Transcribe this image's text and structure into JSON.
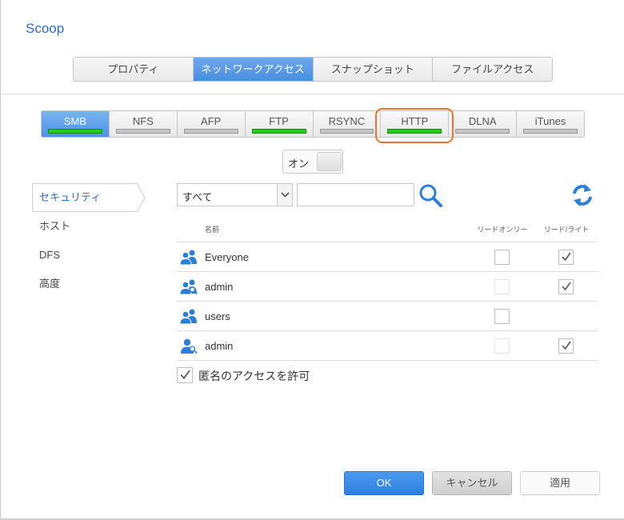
{
  "window": {
    "title": "Scoop"
  },
  "main_tabs": [
    {
      "label": "プロパティ",
      "active": false
    },
    {
      "label": "ネットワークアクセス",
      "active": true
    },
    {
      "label": "スナップショット",
      "active": false
    },
    {
      "label": "ファイルアクセス",
      "active": false
    }
  ],
  "protocol_tabs": [
    {
      "label": "SMB",
      "active": true,
      "enabled": true
    },
    {
      "label": "NFS",
      "active": false,
      "enabled": false
    },
    {
      "label": "AFP",
      "active": false,
      "enabled": false
    },
    {
      "label": "FTP",
      "active": false,
      "enabled": true
    },
    {
      "label": "RSYNC",
      "active": false,
      "enabled": false
    },
    {
      "label": "HTTP",
      "active": false,
      "enabled": true,
      "highlighted": true
    },
    {
      "label": "DLNA",
      "active": false,
      "enabled": false
    },
    {
      "label": "iTunes",
      "active": false,
      "enabled": false
    }
  ],
  "service_toggle": {
    "label": "オン"
  },
  "side_nav": [
    {
      "label": "セキュリティ",
      "active": true
    },
    {
      "label": "ホスト",
      "active": false
    },
    {
      "label": "DFS",
      "active": false
    },
    {
      "label": "高度",
      "active": false
    }
  ],
  "filter": {
    "selected": "すべて",
    "search_value": ""
  },
  "permissions": {
    "headers": {
      "name": "名前",
      "read_only": "リードオンリー",
      "read_write": "リード/ライト"
    },
    "rows": [
      {
        "name": "Everyone",
        "type": "group",
        "read_only": false,
        "read_only_dim": false,
        "read_write": true,
        "read_write_visible": true
      },
      {
        "name": "admin",
        "type": "admin-group",
        "read_only": false,
        "read_only_dim": true,
        "read_write": true,
        "read_write_visible": true
      },
      {
        "name": "users",
        "type": "group",
        "read_only": false,
        "read_only_dim": false,
        "read_write": false,
        "read_write_visible": false
      },
      {
        "name": "admin",
        "type": "admin-user",
        "read_only": false,
        "read_only_dim": true,
        "read_write": true,
        "read_write_visible": true
      }
    ]
  },
  "anonymous_access": {
    "label": "匿名のアクセスを許可",
    "checked": true
  },
  "buttons": {
    "ok": "OK",
    "cancel": "キャンセル",
    "apply": "適用"
  },
  "colors": {
    "accent": "#2b6fc4",
    "enabled_bar": "#22cc1a",
    "highlight": "#e8742a",
    "icon_blue": "#2a7fd8"
  }
}
